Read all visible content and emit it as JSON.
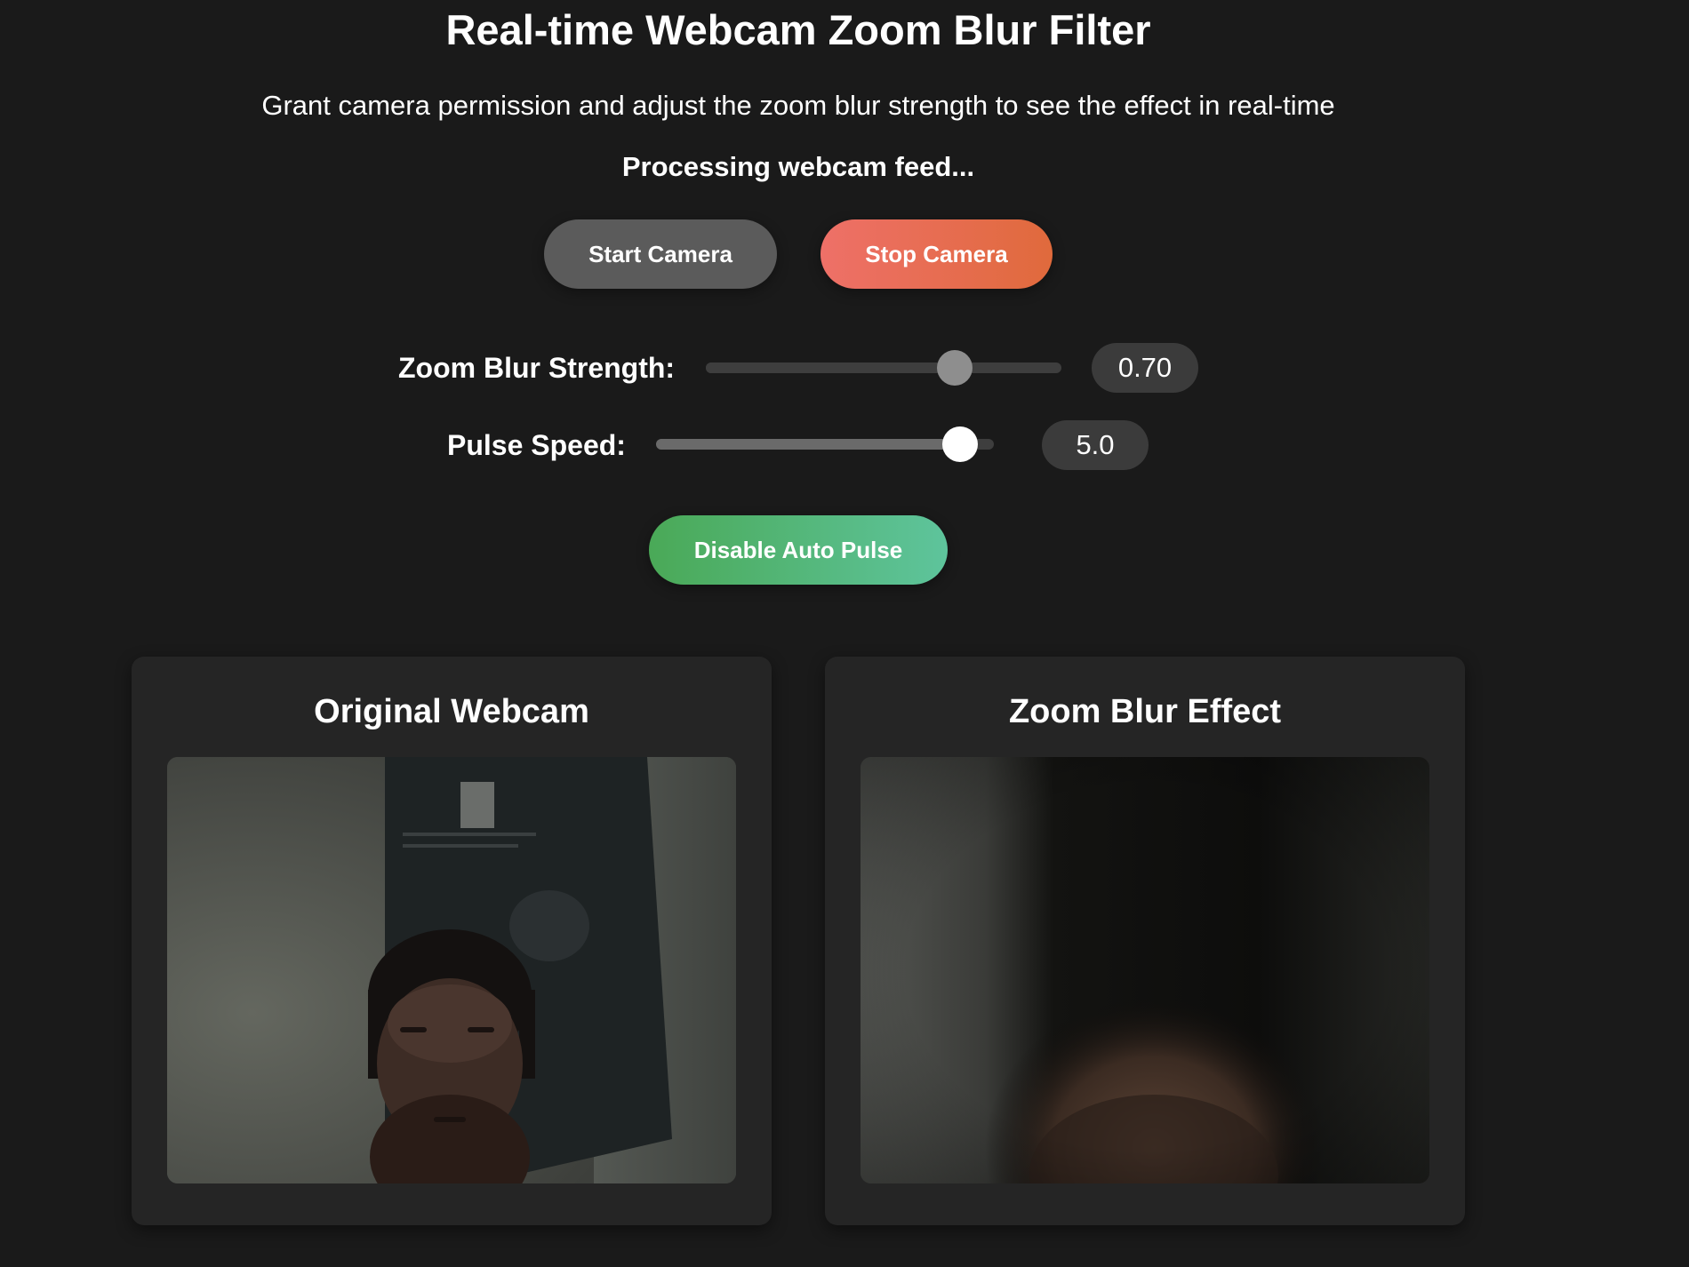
{
  "header": {
    "title": "Real-time Webcam Zoom Blur Filter",
    "subtitle": "Grant camera permission and adjust the zoom blur strength to see the effect in real-time",
    "status": "Processing webcam feed..."
  },
  "buttons": {
    "start_label": "Start Camera",
    "stop_label": "Stop Camera",
    "pulse_toggle_label": "Disable Auto Pulse"
  },
  "controls": {
    "zoom_blur": {
      "label": "Zoom Blur Strength:",
      "value_text": "0.70",
      "value": 0.7,
      "min": 0,
      "max": 1
    },
    "pulse_speed": {
      "label": "Pulse Speed:",
      "value_text": "5.0",
      "value": 5.0,
      "min": 0.5,
      "max": 5.5
    }
  },
  "panels": {
    "original": {
      "title": "Original Webcam"
    },
    "effect": {
      "title": "Zoom Blur Effect"
    }
  },
  "colors": {
    "background": "#1a1a1a",
    "start_button": "#5b5b5b",
    "stop_button_start": "#ee7068",
    "stop_button_end": "#e06a3c",
    "pulse_button_start": "#4aa957",
    "pulse_button_end": "#5ec49c"
  }
}
